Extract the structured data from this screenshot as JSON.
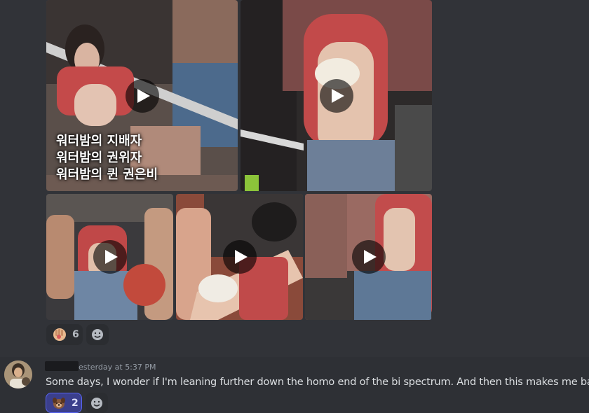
{
  "post_1": {
    "caption_lines": [
      "워터밤의 지배자",
      "워터밤의 권위자",
      "워터밤의 퀸 권은비"
    ],
    "reaction": {
      "emoji": "raised-hand-emoji",
      "count": "6"
    },
    "media_count": 5
  },
  "message": {
    "timestamp": "esterday at 5:37 PM",
    "text": "Some days, I wonder if I'm leaning further down the homo end of the bi spectrum. And then this makes me bark.",
    "reaction": {
      "emoji": "dog-face-emoji",
      "count": "2"
    }
  },
  "colors": {
    "background": "#313338",
    "message_hover": "#2e3035",
    "reaction_bg": "#2b2d31",
    "reaction_active_bg": "#3b3f8c",
    "reaction_active_border": "#5865f2",
    "text": "#dbdee1",
    "muted": "#949ba4"
  }
}
